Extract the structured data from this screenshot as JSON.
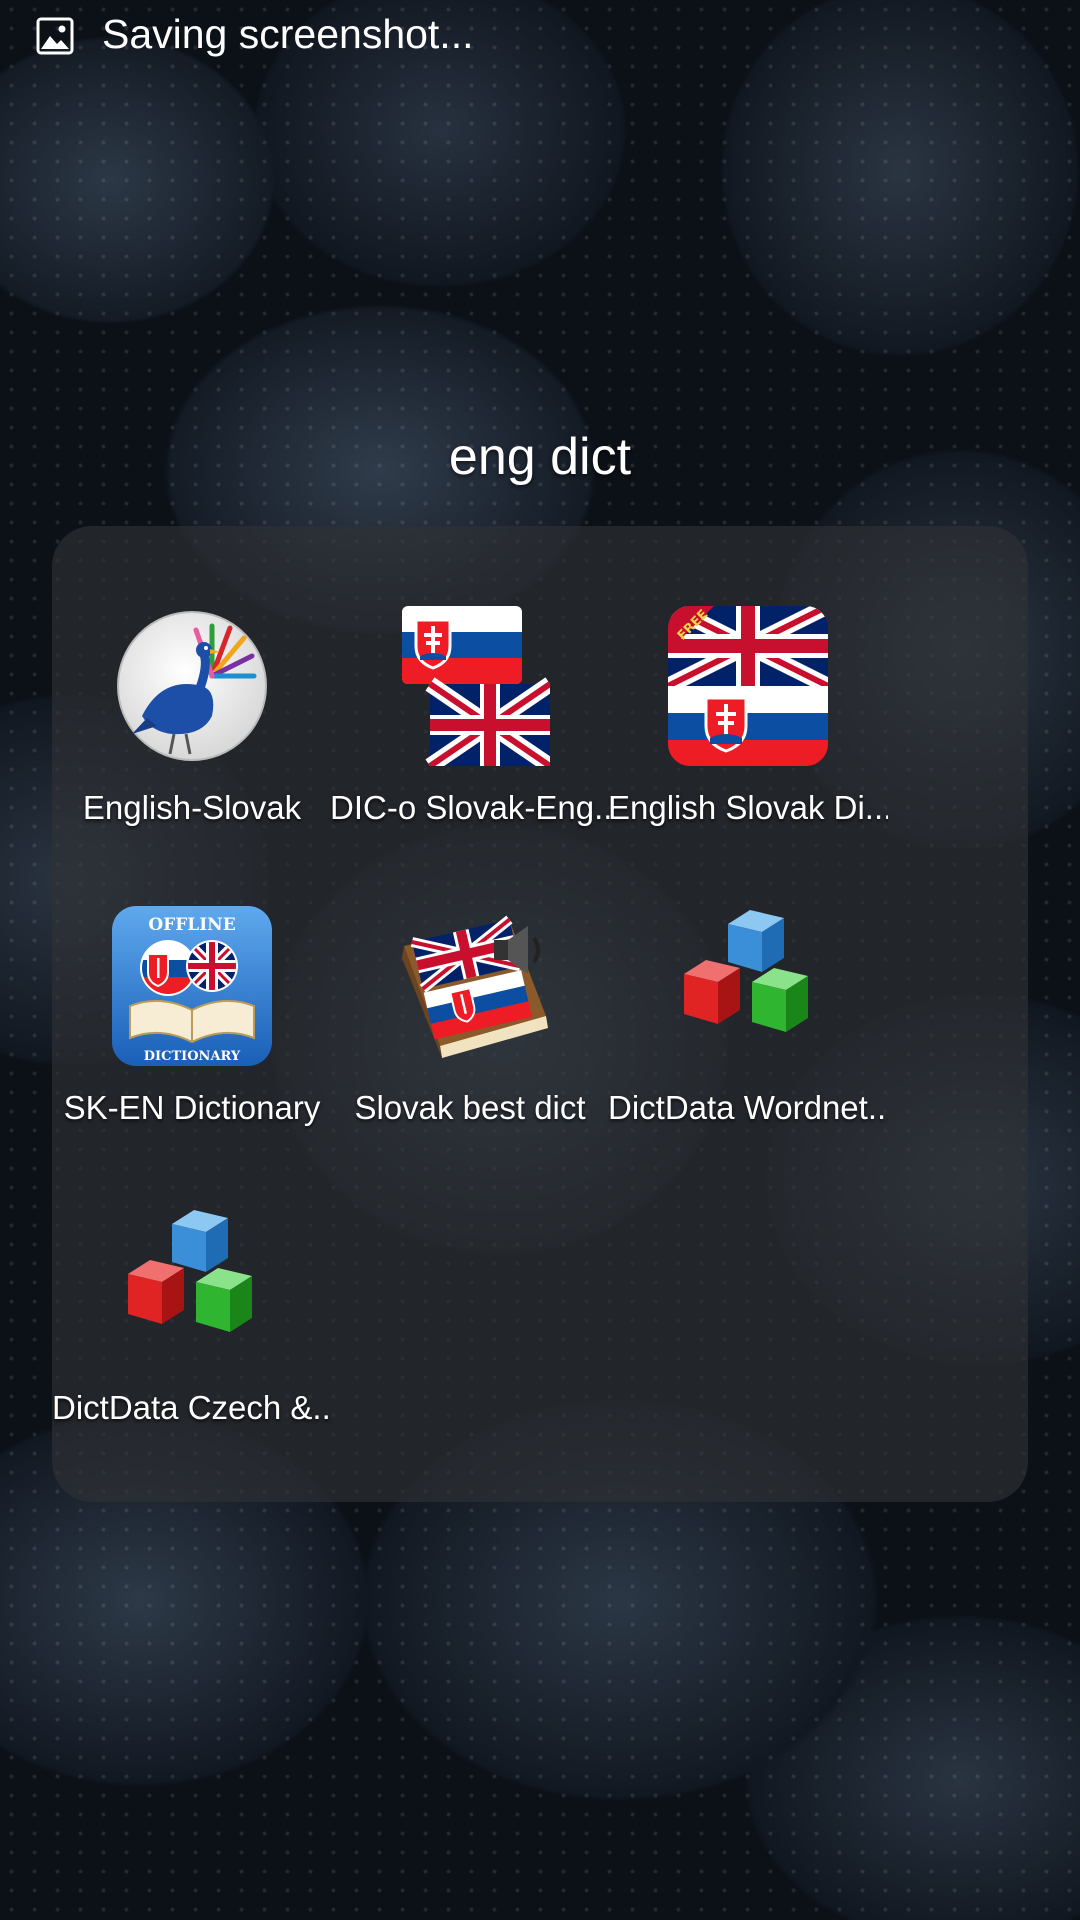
{
  "status_bar": {
    "notification_icon": "image-icon",
    "text": "Saving screenshot..."
  },
  "folder": {
    "title": "eng dict"
  },
  "apps": [
    {
      "label": "English-Slovak",
      "icon": "peacock-icon"
    },
    {
      "label": "DIC-o Slovak-Eng...",
      "icon": "slovak-uk-flags-icon"
    },
    {
      "label": "English Slovak Di...",
      "icon": "uk-slovak-free-icon"
    },
    {
      "label": "SK-EN Dictionary",
      "icon": "offline-dictionary-icon"
    },
    {
      "label": "Slovak best dict",
      "icon": "book-speaker-icon"
    },
    {
      "label": "DictData Wordnet...",
      "icon": "cubes-icon"
    },
    {
      "label": "DictData Czech &...",
      "icon": "cubes-icon"
    }
  ],
  "icon_badges": {
    "free": "FREE",
    "offline": "OFFLINE",
    "dictionary": "DICTIONARY"
  },
  "colors": {
    "slovak_white": "#ffffff",
    "slovak_blue": "#0b4ea2",
    "slovak_red": "#ee1c25",
    "uk_blue": "#012169",
    "uk_red": "#c8102e"
  }
}
